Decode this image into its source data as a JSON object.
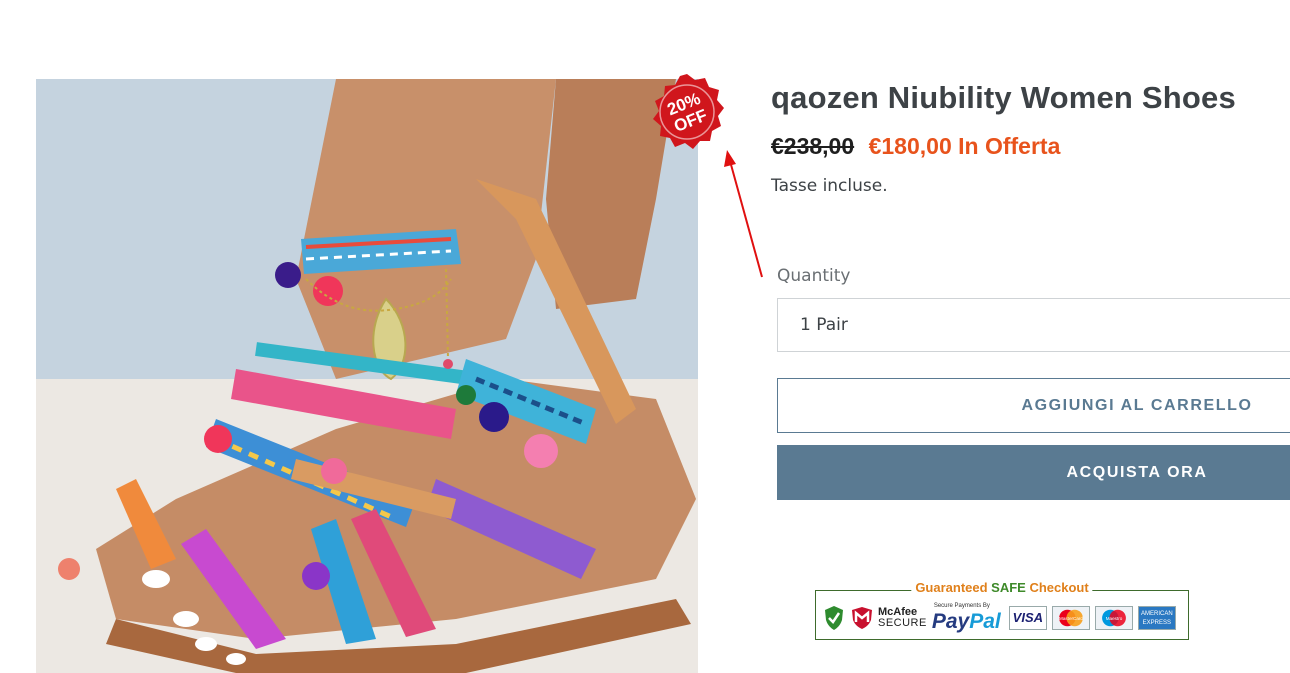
{
  "product": {
    "title": "qaozen Niubility Women Shoes",
    "price_original": "€238,00",
    "price_sale": "€180,00 In Offerta",
    "tax_note": "Tasse incluse.",
    "image_alt": "Colorful woven pom-pom sandals"
  },
  "badge": {
    "line1": "20%",
    "line2": "OFF"
  },
  "quantity": {
    "label": "Quantity",
    "selected": "1 Pair"
  },
  "buttons": {
    "add_to_cart": "AGGIUNGI AL CARRELLO",
    "buy_now": "ACQUISTA ORA"
  },
  "safe_checkout": {
    "title_prefix": "Guaranteed ",
    "title_safe": "SAFE",
    "title_suffix": " Checkout",
    "mcafee_line1": "McAfee",
    "mcafee_line2": "SECURE",
    "paypal_small": "Secure Payments By",
    "paypal_pay": "Pay",
    "paypal_pal": "Pal",
    "visa": "VISA",
    "mastercard": "MasterCard",
    "maestro": "Maestro",
    "amex_line1": "AMERICAN",
    "amex_line2": "EXPRESS"
  },
  "colors": {
    "sale_price": "#e8531c",
    "button_primary": "#5a7a92",
    "badge_red": "#d0161c",
    "annotation_arrow": "#e01010"
  }
}
